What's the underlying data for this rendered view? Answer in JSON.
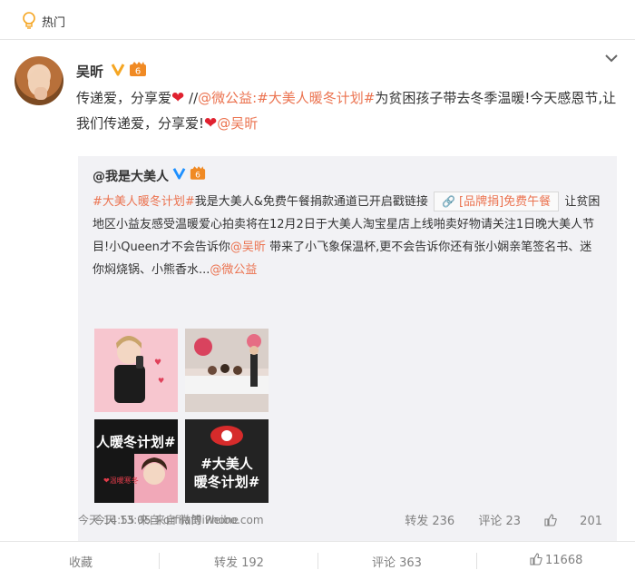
{
  "hot": {
    "label": "热门"
  },
  "post": {
    "username": "吴昕",
    "text_prefix": "传递爱，分享爱",
    "separator": "//",
    "mention_weigongyi": "@微公益",
    "topic": ":#大美人暖冬计划#",
    "text_middle": "为贫困孩子带去冬季温暖!今天感恩节,让我们传递爱，分享爱!",
    "mention_wuxin": "@吴昕",
    "meta": "今天 14:55 来自 orfila的iPhone"
  },
  "repost": {
    "username": "@我是大美人",
    "topic": "#大美人暖冬计划#",
    "text_1": "我是大美人&免费午餐捐款通道已开启戳链接",
    "pill_label": "[品牌捐]免费午餐",
    "text_2": "让贫困地区小益友感受温暖爱心拍卖将在12月2日于大美人淘宝星店上线啪卖好物请关注1日晚大美人节目!小Queen才不会告诉你",
    "mention_wuxin": "@吴昕",
    "text_3": "带来了小飞象保温杯,更不会告诉你还有张小娴亲笔签名书、迷你焖烧锅、小熊香水...",
    "mention_weigongyi": "@微公益",
    "thumb3_text": "人暖冬计划#",
    "thumb4_line1": "#大美人",
    "thumb4_line2": "暖冬计划#",
    "meta": "今天 13:05 来自 微博 weibo.com",
    "repost_count": "转发 236",
    "comment_count": "评论 23",
    "like_count": "201"
  },
  "footer": {
    "collect": "收藏",
    "repost": "转发 192",
    "comment": "评论 363",
    "like": "11668"
  },
  "colors": {
    "link": "#eb7350",
    "verify": "#f5a623",
    "muted": "#808080",
    "repost_bg": "#f2f2f5"
  }
}
